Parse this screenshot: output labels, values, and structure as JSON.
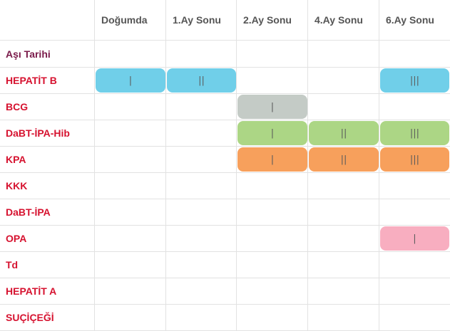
{
  "colors": {
    "date_row_label": "#7a1a4a",
    "vaccine_label": "#d6122f",
    "header_text": "#555555",
    "blue": "#70cfe9",
    "gray": "#c4cbc6",
    "green": "#acd685",
    "orange": "#f7a05c",
    "pink": "#f8aec0"
  },
  "columns": [
    "Doğumda",
    "1.Ay Sonu",
    "2.Ay Sonu",
    "4.Ay Sonu",
    "6.Ay Sonu"
  ],
  "rows": [
    {
      "label": "Aşı Tarihi"
    },
    {
      "label": "HEPATİT B"
    },
    {
      "label": "BCG"
    },
    {
      "label": "DaBT-İPA-Hib"
    },
    {
      "label": "KPA"
    },
    {
      "label": "KKK"
    },
    {
      "label": "DaBT-İPA"
    },
    {
      "label": "OPA"
    },
    {
      "label": "Td"
    },
    {
      "label": "HEPATİT A"
    },
    {
      "label": "SUÇİÇEĞİ"
    }
  ],
  "doses": [
    {
      "row": 1,
      "col": 0,
      "label": "|",
      "color": "blue"
    },
    {
      "row": 1,
      "col": 1,
      "label": "||",
      "color": "blue"
    },
    {
      "row": 1,
      "col": 4,
      "label": "|||",
      "color": "blue"
    },
    {
      "row": 2,
      "col": 2,
      "label": "|",
      "color": "gray"
    },
    {
      "row": 3,
      "col": 2,
      "label": "|",
      "color": "green"
    },
    {
      "row": 3,
      "col": 3,
      "label": "||",
      "color": "green"
    },
    {
      "row": 3,
      "col": 4,
      "label": "|||",
      "color": "green"
    },
    {
      "row": 4,
      "col": 2,
      "label": "|",
      "color": "orange"
    },
    {
      "row": 4,
      "col": 3,
      "label": "||",
      "color": "orange"
    },
    {
      "row": 4,
      "col": 4,
      "label": "|||",
      "color": "orange"
    },
    {
      "row": 7,
      "col": 4,
      "label": "|",
      "color": "pink"
    }
  ]
}
